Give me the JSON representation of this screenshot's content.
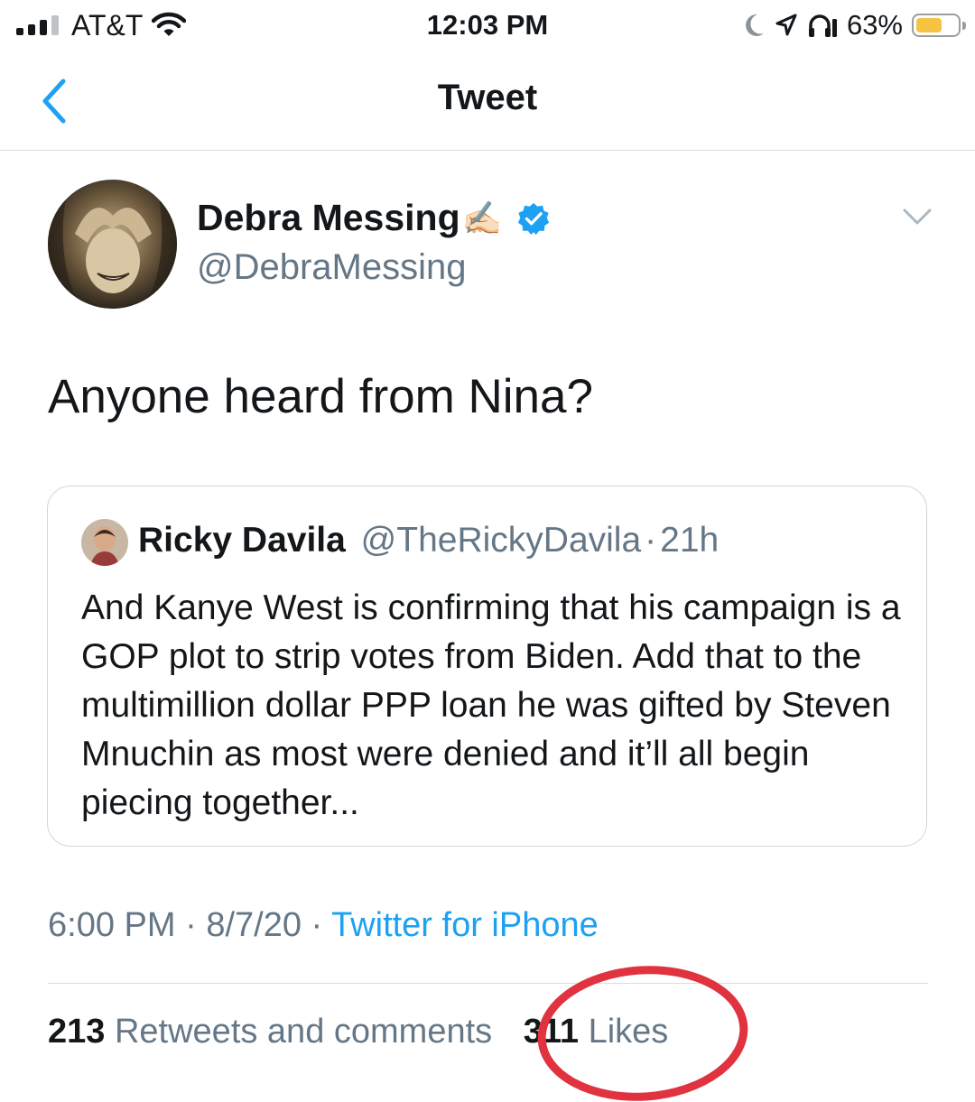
{
  "status_bar": {
    "carrier": "AT&T",
    "time": "12:03 PM",
    "battery_percent": "63%",
    "battery_level": 0.63,
    "icons": [
      "signal-icon",
      "wifi-icon",
      "moon-icon",
      "location-icon",
      "headphones-icon",
      "battery-icon"
    ]
  },
  "header": {
    "title": "Tweet",
    "back_icon": "chevron-left-icon"
  },
  "tweet": {
    "author_name": "Debra Messing",
    "author_emoji": "✍🏻",
    "handle": "@DebraMessing",
    "verified": true,
    "text": "Anyone heard from Nina?",
    "time": "6:00 PM",
    "date": "8/7/20",
    "separator": "·",
    "source": "Twitter for iPhone",
    "menu_icon": "chevron-down-icon"
  },
  "quoted_tweet": {
    "author_name": "Ricky Davila",
    "handle": "@TheRickyDavila",
    "separator": "·",
    "time_ago": "21h",
    "text": "And Kanye West is confirming that his campaign is a GOP plot to strip votes from Biden. Add that to the multimillion dollar PPP loan he was gifted by Steven Mnuchin as most were denied and it’ll all begin piecing together..."
  },
  "stats": {
    "retweets_count": "213",
    "retweets_label": "Retweets and comments",
    "likes_count": "311",
    "likes_label": "Likes"
  },
  "colors": {
    "link_blue": "#1da1f2",
    "secondary_text": "#657786",
    "annotation_red": "#e0323f",
    "battery_yellow": "#f6c343"
  }
}
